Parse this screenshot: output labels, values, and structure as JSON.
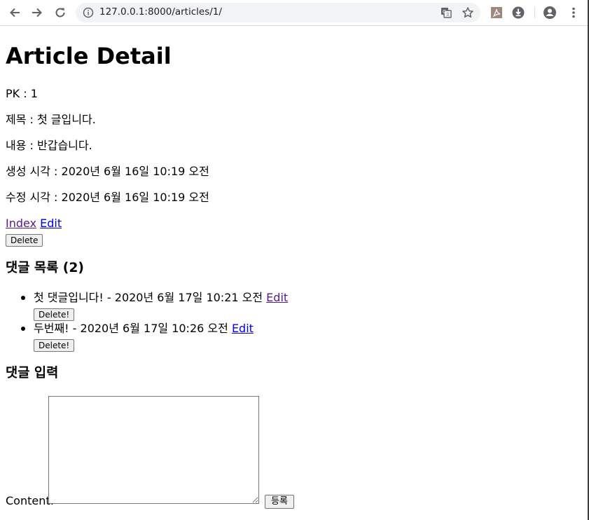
{
  "browser": {
    "url": "127.0.0.1:8000/articles/1/"
  },
  "article": {
    "heading": "Article Detail",
    "pk": "PK : 1",
    "title": "제목 : 첫 글입니다.",
    "content": "내용 : 반갑습니다.",
    "created": "생성 시각 : 2020년 6월 16일 10:19 오전",
    "updated": "수정 시각 : 2020년 6월 16일 10:19 오전",
    "links": {
      "index": "Index",
      "edit": "Edit"
    },
    "delete_label": "Delete"
  },
  "comments": {
    "heading": "댓글 목록 (2)",
    "items": [
      {
        "text": "첫 댓글입니다! - 2020년 6월 17일 10:21 오전",
        "edit": "Edit",
        "delete": "Delete!"
      },
      {
        "text": "두번째! - 2020년 6월 17일 10:26 오전",
        "edit": "Edit",
        "delete": "Delete!"
      }
    ]
  },
  "form": {
    "heading": "댓글 입력",
    "content_label": "Content:",
    "submit_label": "등록"
  },
  "colors": {
    "link": "#0000ee",
    "visited_link": "#551a8b",
    "omnibox_bg": "#f1f3f4"
  }
}
